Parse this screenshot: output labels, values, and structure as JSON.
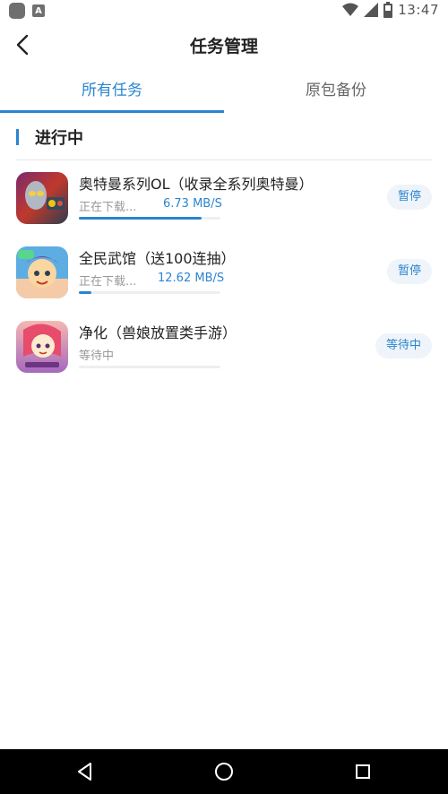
{
  "status_bar": {
    "time": "13:47",
    "left_icons": [
      "app-notification-icon",
      "a-notification-icon"
    ],
    "right_icons": [
      "wifi-icon",
      "signal-icon",
      "battery-icon"
    ]
  },
  "header": {
    "title": "任务管理",
    "back_icon": "back-arrow-icon"
  },
  "tabs": [
    {
      "label": "所有任务",
      "active": true
    },
    {
      "label": "原包备份",
      "active": false
    }
  ],
  "section": {
    "title": "进行中"
  },
  "tasks": [
    {
      "title": "奥特曼系列OL（收录全系列奥特曼）",
      "status": "正在下载...",
      "speed": "6.73 MB/S",
      "progress": 0.87,
      "action": "暂停"
    },
    {
      "title": "全民武馆（送100连抽）",
      "status": "正在下载...",
      "speed": "12.62 MB/S",
      "progress": 0.09,
      "action": "暂停"
    },
    {
      "title": "净化（兽娘放置类手游）",
      "status": "等待中",
      "speed": "",
      "progress": 0.0,
      "action": "等待中"
    }
  ],
  "colors": {
    "accent": "#2a85d0",
    "button_bg": "#eef4fa",
    "nav_bg": "#000000"
  },
  "nav": [
    "back-triangle-icon",
    "home-circle-icon",
    "recents-square-icon"
  ]
}
